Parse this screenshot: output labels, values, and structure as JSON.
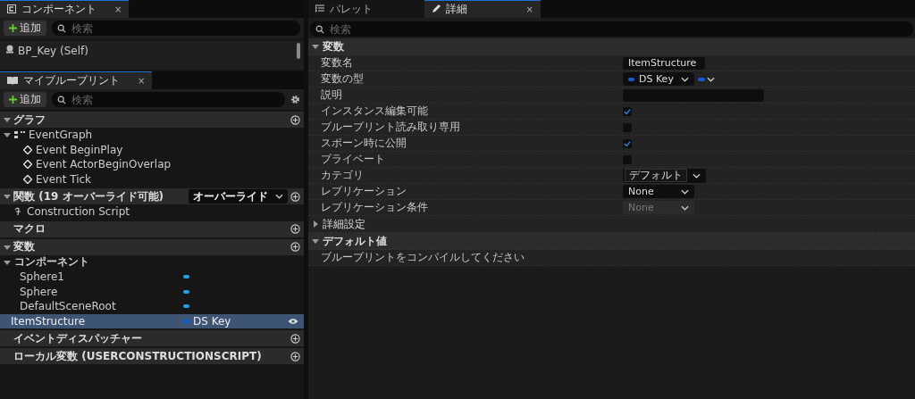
{
  "components_panel": {
    "tab": {
      "label": "コンポーネント",
      "close": "×"
    },
    "add_button": "追加",
    "search": {
      "placeholder": "検索"
    },
    "items": [
      {
        "label": "BP_Key (Self)"
      }
    ]
  },
  "my_blueprint": {
    "tab": {
      "label": "マイブループリント",
      "close": "×"
    },
    "add_button": "追加",
    "search": {
      "placeholder": "検索"
    },
    "sections": [
      {
        "title": "グラフ",
        "expanded": true,
        "items": [
          {
            "kind": "graph",
            "label": "EventGraph",
            "expanded": true,
            "children": [
              {
                "kind": "event",
                "label": "Event BeginPlay"
              },
              {
                "kind": "event",
                "label": "Event ActorBeginOverlap"
              },
              {
                "kind": "event",
                "label": "Event Tick"
              }
            ]
          }
        ]
      },
      {
        "title": "関数 (19 オーバーライド可能)",
        "expanded": true,
        "dropdown": "オーバーライド",
        "items": [
          {
            "kind": "function",
            "label": "Construction Script"
          }
        ]
      },
      {
        "title": "マクロ"
      },
      {
        "title": "変数",
        "expanded": true,
        "items": [
          {
            "kind": "category",
            "label": "コンポーネント",
            "expanded": true,
            "children": [
              {
                "kind": "variable",
                "label": "Sphere1",
                "color": "#1ca3ec",
                "selected": false
              },
              {
                "kind": "variable",
                "label": "Sphere",
                "color": "#1ca3ec",
                "selected": false
              },
              {
                "kind": "variable",
                "label": "DefaultSceneRoot",
                "color": "#1ca3ec",
                "selected": false
              }
            ]
          },
          {
            "kind": "variable",
            "label": "ItemStructure",
            "type": "DS Key",
            "color": "#0a5ed8",
            "selected": true
          }
        ]
      },
      {
        "title": "イベントディスパッチャー"
      },
      {
        "title": "ローカル変数 (USERCONSTRUCTIONSCRIPT)"
      }
    ]
  },
  "details_panel": {
    "tabs": [
      {
        "label": "パレット",
        "selected": false
      },
      {
        "label": "詳細",
        "selected": true,
        "close": "×"
      }
    ],
    "search": {
      "placeholder": "検索"
    },
    "sections": [
      {
        "kind": "category",
        "title": "変数",
        "expanded": true,
        "rows": [
          {
            "label": "変数名",
            "kind": "text",
            "value": "ItemStructure"
          },
          {
            "label": "変数の型",
            "kind": "type",
            "value": "DS Key",
            "color": "#0a5ed8"
          },
          {
            "label": "説明",
            "kind": "textarea"
          },
          {
            "label": "インスタンス編集可能",
            "kind": "checkbox",
            "checked": true
          },
          {
            "label": "ブループリント読み取り専用",
            "kind": "checkbox",
            "checked": false
          },
          {
            "label": "スポーン時に公開",
            "kind": "checkbox",
            "checked": true
          },
          {
            "label": "プライベート",
            "kind": "checkbox",
            "checked": false
          },
          {
            "label": "カテゴリ",
            "kind": "combo",
            "value": "デフォルト"
          },
          {
            "label": "レプリケーション",
            "kind": "dropdown",
            "value": "None",
            "disabled": false
          },
          {
            "label": "レプリケーション条件",
            "kind": "dropdown",
            "value": "None",
            "disabled": true
          }
        ]
      },
      {
        "kind": "group",
        "title": "詳細設定",
        "expanded": false
      },
      {
        "kind": "category",
        "title": "デフォルト値",
        "expanded": true,
        "rows": [
          {
            "kind": "message",
            "label": "ブループリントをコンパイルしてください"
          }
        ]
      }
    ]
  }
}
